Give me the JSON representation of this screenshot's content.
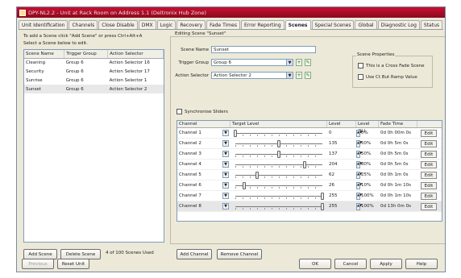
{
  "window": {
    "title": "DPY-NL2.2 - Unit at Rack Room on Address 1.1 (Deltronix Hub Zone)"
  },
  "tabs": [
    {
      "label": "Unit Identification"
    },
    {
      "label": "Channels"
    },
    {
      "label": "Close Disable"
    },
    {
      "label": "DMX"
    },
    {
      "label": "Logic"
    },
    {
      "label": "Recovery"
    },
    {
      "label": "Fade Times"
    },
    {
      "label": "Error Reporting"
    },
    {
      "label": "Scenes"
    },
    {
      "label": "Special Scenes"
    },
    {
      "label": "Global"
    },
    {
      "label": "Diagnostic Log"
    },
    {
      "label": "Status"
    }
  ],
  "active_tab": "Scenes",
  "left": {
    "instruction_line1": "To add a Scene click \"Add Scene\" or press Ctrl+Alt+A",
    "instruction_line2": "Select a Scene below to edit.",
    "columns": [
      "Scene Name",
      "Trigger Group",
      "Action Selector"
    ],
    "rows": [
      {
        "name": "Cleaning",
        "group": "Group 6",
        "action": "Action Selector 16"
      },
      {
        "name": "Security",
        "group": "Group 6",
        "action": "Action Selector 17"
      },
      {
        "name": "Sunrise",
        "group": "Group 6",
        "action": "Action Selector 1"
      },
      {
        "name": "Sunset",
        "group": "Group 6",
        "action": "Action Selector 2"
      }
    ],
    "add_scene": "Add Scene",
    "delete_scene": "Delete Scene",
    "count_text": "4 of 100 Scenes Used"
  },
  "editor": {
    "group_label": "Editing Scene \"Sunset\"",
    "scene_name_label": "Scene Name",
    "scene_name_value": "Sunset",
    "trigger_group_label": "Trigger Group",
    "trigger_group_value": "Group 6",
    "action_selector_label": "Action Selector",
    "action_selector_value": "Action Selector 2",
    "synchronise_label": "Synchronise Sliders",
    "properties_label": "Scene Properties",
    "cross_fade_label": "This is a Cross Fade Scene",
    "ramp_value_label": "Use Ct But Ramp Value",
    "columns": [
      "Channel",
      "Target Level",
      "Level",
      "Level (%)",
      "Fade Time"
    ],
    "channels": [
      {
        "name": "Channel 1",
        "level": "0",
        "pct": "0%",
        "fade": "0d 0h 00m 0s",
        "slider": 0.0
      },
      {
        "name": "Channel 2",
        "level": "135",
        "pct": "50%",
        "fade": "0d 0h 5m 0s",
        "slider": 0.5
      },
      {
        "name": "Channel 3",
        "level": "137",
        "pct": "50%",
        "fade": "0d 0h 5m 0s",
        "slider": 0.5
      },
      {
        "name": "Channel 4",
        "level": "204",
        "pct": "80%",
        "fade": "0d 0h 5m 0s",
        "slider": 0.8
      },
      {
        "name": "Channel 5",
        "level": "62",
        "pct": "25%",
        "fade": "0d 0h 1m 0s",
        "slider": 0.25
      },
      {
        "name": "Channel 6",
        "level": "26",
        "pct": "10%",
        "fade": "0d 0h 1m 10s",
        "slider": 0.1
      },
      {
        "name": "Channel 7",
        "level": "255",
        "pct": "100%",
        "fade": "0d 0h 1m 10s",
        "slider": 1.0
      },
      {
        "name": "Channel 8",
        "level": "255",
        "pct": "100%",
        "fade": "0d 13h 0m 0s",
        "slider": 1.0
      }
    ],
    "edit_label": "Edit",
    "add_channel": "Add Channel",
    "remove_channel": "Remove Channel"
  },
  "footer": {
    "prev_unit": "Previous",
    "reset_unit": "Reset Unit",
    "ok": "OK",
    "cancel": "Cancel",
    "apply": "Apply",
    "help": "Help"
  }
}
